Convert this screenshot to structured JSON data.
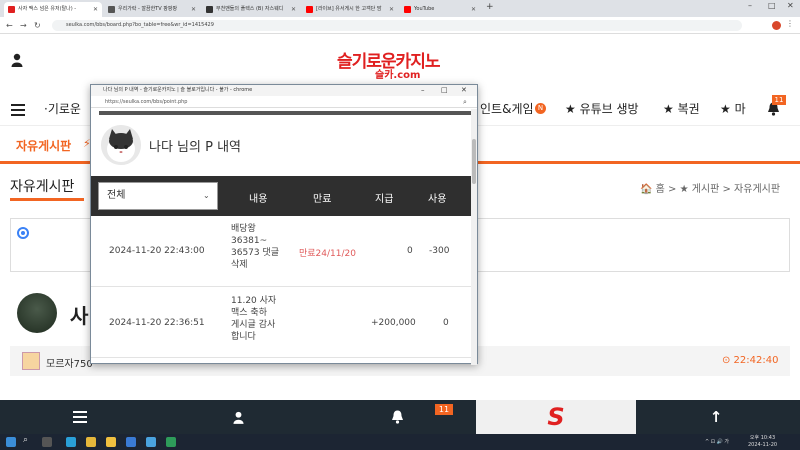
{
  "browser": {
    "tabs": [
      {
        "label": "사자 맥스 넘은 유저(탈나) - ",
        "color": "#e02020"
      },
      {
        "label": "우리가락 - 깔끔한TV 팡팡팡",
        "color": "#555555"
      },
      {
        "label": "부천맨들의 플렉스 (B) 자스웨디",
        "color": "#333333"
      },
      {
        "label": "[라이브] 유서게시 한 고객단 맘",
        "color": "#ff0000"
      },
      {
        "label": "YouTube",
        "color": "#ff0000"
      }
    ],
    "url": "seulka.com/bbs/board.php?bo_table=free&wr_id=1415429"
  },
  "site": {
    "logo_main": "슬기로운카지노",
    "logo_sub": "슬카.com",
    "nav_left": "·기로운",
    "nav_items": [
      "인트&게임",
      "★ 유튜브 생방",
      "★ 복권",
      "★ 마"
    ],
    "nav_badge": "N",
    "notif_count": "11",
    "subnav_label": "자유게시판",
    "board_title": "자유게시판",
    "breadcrumb": "🏠 홈 > ★ 게시판 > 자유게시판",
    "post_title": "사",
    "author": "모르자750",
    "post_time": "⊙ 22:42:40",
    "bottom_notif": "11"
  },
  "popup": {
    "title": "나다 님의 P 내역 - 슬기로운카지노 | 슬 블로거입니다 - 불가 - chrome",
    "url": "https://seulka.com/bbs/point.php",
    "heading": "나다 님의 P 내역",
    "select_value": "전체",
    "columns": [
      "내용",
      "만료",
      "지급",
      "사용"
    ],
    "rows": [
      {
        "date": "2024-11-20 22:43:00",
        "content": [
          "배당왕",
          "36381~",
          "36573 댓글",
          "삭제"
        ],
        "expire": "만료24/11/20",
        "given": "0",
        "used": "-300"
      },
      {
        "date": "2024-11-20 22:36:51",
        "content": [
          "11.20 사자",
          "맥스 축하",
          "게시글 감사",
          "합니다"
        ],
        "expire": "",
        "given": "+200,000",
        "used": "0"
      }
    ]
  },
  "taskbar": {
    "time": "오후 10:43",
    "date": "2024-11-20"
  }
}
